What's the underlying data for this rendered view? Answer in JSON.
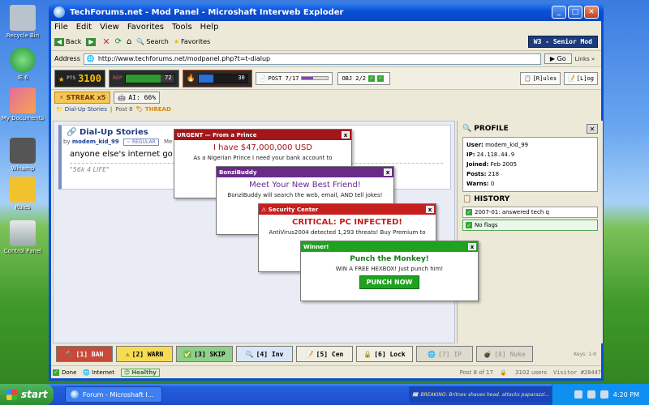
{
  "desktop": {
    "icons": [
      {
        "label": "Recycle Bin",
        "icon": "recycle-bin-icon"
      },
      {
        "label": "IE 6",
        "icon": "ie-icon"
      },
      {
        "label": "My Documents",
        "icon": "documents-icon"
      },
      {
        "label": "Winamp",
        "icon": "winamp-icon"
      },
      {
        "label": "Rules",
        "icon": "rules-icon"
      },
      {
        "label": "Control Panel",
        "icon": "control-panel-icon"
      }
    ]
  },
  "window": {
    "title": "TechForums.net - Mod Panel - Microshaft Interweb Exploder",
    "menu": [
      "File",
      "Edit",
      "View",
      "Favorites",
      "Tools",
      "Help"
    ],
    "toolbar": {
      "back": "Back",
      "search": "Search",
      "favorites": "Favorites",
      "rank": "W3 - Senior Mod"
    },
    "address": {
      "label": "Address",
      "url": "http://www.techforums.net/modpanel.php?t=t-dialup",
      "go": "Go",
      "links": "Links »"
    }
  },
  "hud": {
    "pts_label": "PTS",
    "pts": "3100",
    "rep_label": "REP",
    "rep": "72",
    "rep_value": 72,
    "heat": "30",
    "heat_value": 30,
    "post_label": "POST 7/17",
    "post_progress": 0.41,
    "obj_label": "OBJ 2/2",
    "rules_btn": "[R]ules",
    "log_btn": "[L]og",
    "streak": "STREAK x5",
    "ai": "AI: 66%"
  },
  "breadcrumb": {
    "forum": "Dial-Up Stories",
    "post": "Post 8",
    "thread": "THREAD"
  },
  "thread": {
    "title": "Dial-Up Stories",
    "by": "by",
    "author": "modem_kid_99",
    "role": "~ REGULAR",
    "meta": "Me",
    "body": "anyone else's internet go out",
    "sig": "\"56k 4 LIFE\""
  },
  "profile": {
    "title": "PROFILE",
    "user": "modem_kid_99",
    "ip": "24.118.44.9",
    "joined": "Feb 2005",
    "posts": "218",
    "warns": "0",
    "labels": {
      "user": "User:",
      "ip": "IP:",
      "joined": "Joined:",
      "posts": "Posts:",
      "warns": "Warns:"
    }
  },
  "history": {
    "title": "HISTORY",
    "items": [
      "2007-01: answered tech q",
      "No flags"
    ]
  },
  "popups": [
    {
      "title": "URGENT — From a Prince",
      "headline": "I have $47,000,000 USD",
      "body": "As a Nigerian Prince I need your bank account to",
      "color": "#a3171b"
    },
    {
      "title": "BonziBuddy",
      "headline": "Meet Your New Best Friend!",
      "body": "BonziBuddy will search the web, email, AND tell jokes!",
      "color": "#6a2a8a"
    },
    {
      "title": "⚠ Security Center",
      "headline": "CRITICAL: PC INFECTED!",
      "body": "AntiVirus2004 detected 1,293 threats! Buy Premium to",
      "color": "#c71e1e"
    },
    {
      "title": "Winner!",
      "headline": "Punch the Monkey!",
      "body": "WIN A FREE HEXBOX! Just punch him!",
      "button": "PUNCH NOW",
      "color": "#1fa31f"
    }
  ],
  "actions": {
    "ban": "[1] BAN",
    "warn": "[2] WARN",
    "skip": "[3] SKIP",
    "inv": "[4] Inv",
    "cen": "[5] Cen",
    "lock": "[6] Lock",
    "ip": "[7] IP",
    "nuke": "[8] Nuke",
    "keys": "Keys: 1-9"
  },
  "status": {
    "done": "Done",
    "internet": "Internet",
    "healthy": "Healthy",
    "post": "Post 8 of 17",
    "users": "3102 users",
    "visitor": "Visitor #28447"
  },
  "taskbar": {
    "start": "start",
    "task": "Forum - Microshaft I...",
    "ticker": "BREAKING: Britnev shaves head. attacks paparazzi...",
    "time": "4:20 PM"
  },
  "colors": {
    "rep": "#2f9a2f",
    "heat": "#2c6fd6",
    "accent": "#0a4fd4"
  }
}
